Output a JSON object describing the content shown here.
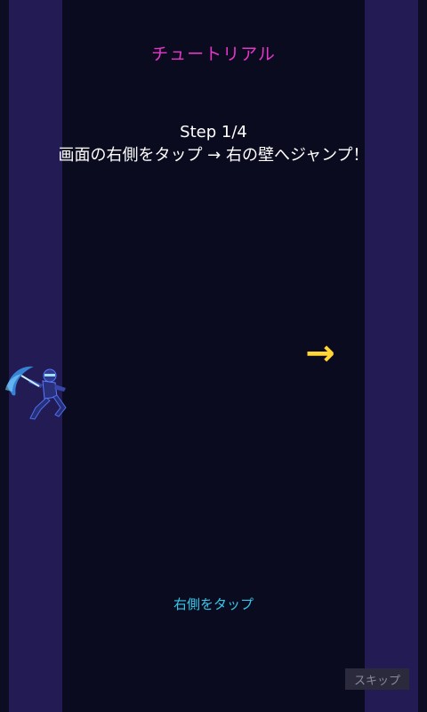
{
  "tutorial": {
    "title": "チュートリアル",
    "step": "Step 1/4",
    "instruction": "画面の右側をタップ → 右の壁へジャンプ！",
    "arrow": "→",
    "hint": "右側をタップ",
    "skip_label": "スキップ"
  },
  "colors": {
    "background": "#0b0b20",
    "wall": "#221b54",
    "title": "#e636c8",
    "arrow": "#ffd633",
    "hint": "#36c6e8"
  },
  "icons": {
    "player": "ninja-character-icon",
    "direction": "right-arrow-icon"
  }
}
